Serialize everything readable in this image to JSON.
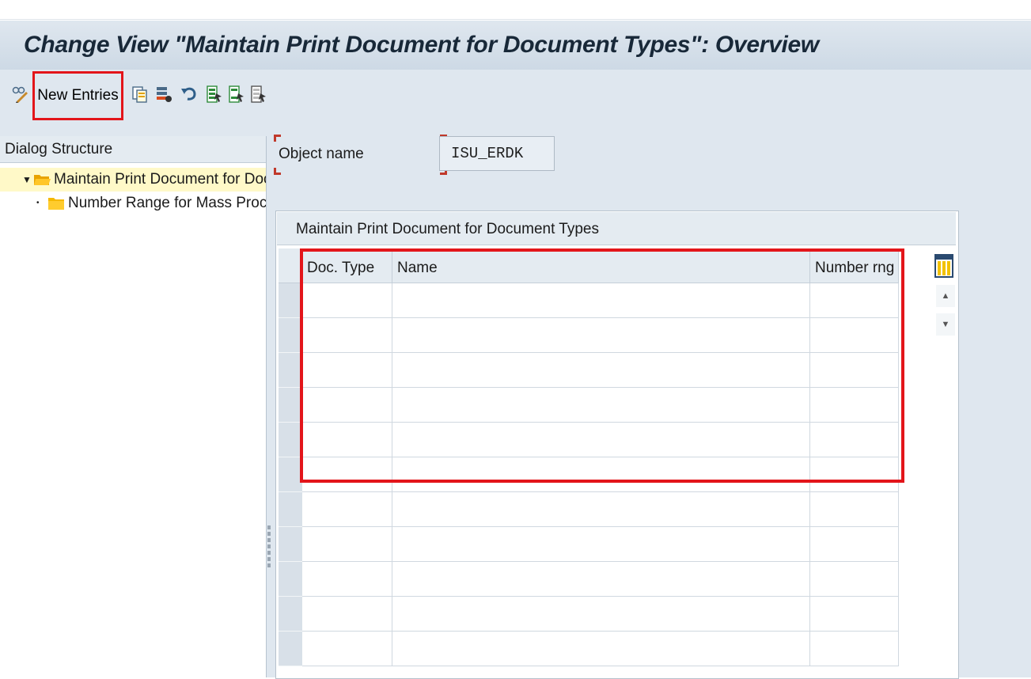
{
  "window": {
    "title": "Change View \"Maintain Print Document for Document Types\": Overview"
  },
  "toolbar": {
    "new_entries_label": "New Entries",
    "icons": [
      "display-change-icon",
      "copy-icon",
      "delete-icon",
      "undo-icon",
      "select-all-icon",
      "select-block-icon",
      "deselect-all-icon"
    ]
  },
  "dialog_structure": {
    "header": "Dialog Structure",
    "items": [
      {
        "label": "Maintain Print Document for Docu",
        "selected": true,
        "expanded": true,
        "icon": "folder-open-icon"
      },
      {
        "label": "Number Range for Mass Process",
        "selected": false,
        "expanded": false,
        "icon": "folder-icon"
      }
    ]
  },
  "object_name": {
    "label": "Object name",
    "value": "ISU_ERDK"
  },
  "table": {
    "title": "Maintain Print Document for Document Types",
    "columns": [
      "Doc. Type",
      "Name",
      "Number rng"
    ],
    "rows": [
      [
        "",
        "",
        ""
      ],
      [
        "",
        "",
        ""
      ],
      [
        "",
        "",
        ""
      ],
      [
        "",
        "",
        ""
      ],
      [
        "",
        "",
        ""
      ],
      [
        "",
        "",
        ""
      ],
      [
        "",
        "",
        ""
      ],
      [
        "",
        "",
        ""
      ],
      [
        "",
        "",
        ""
      ],
      [
        "",
        "",
        ""
      ],
      [
        "",
        "",
        ""
      ]
    ]
  },
  "colors": {
    "highlight": "#e3151a",
    "header_bg": "#dfe7ef",
    "selected_tree_bg": "#fff9c8",
    "folder": "#f5b800"
  }
}
